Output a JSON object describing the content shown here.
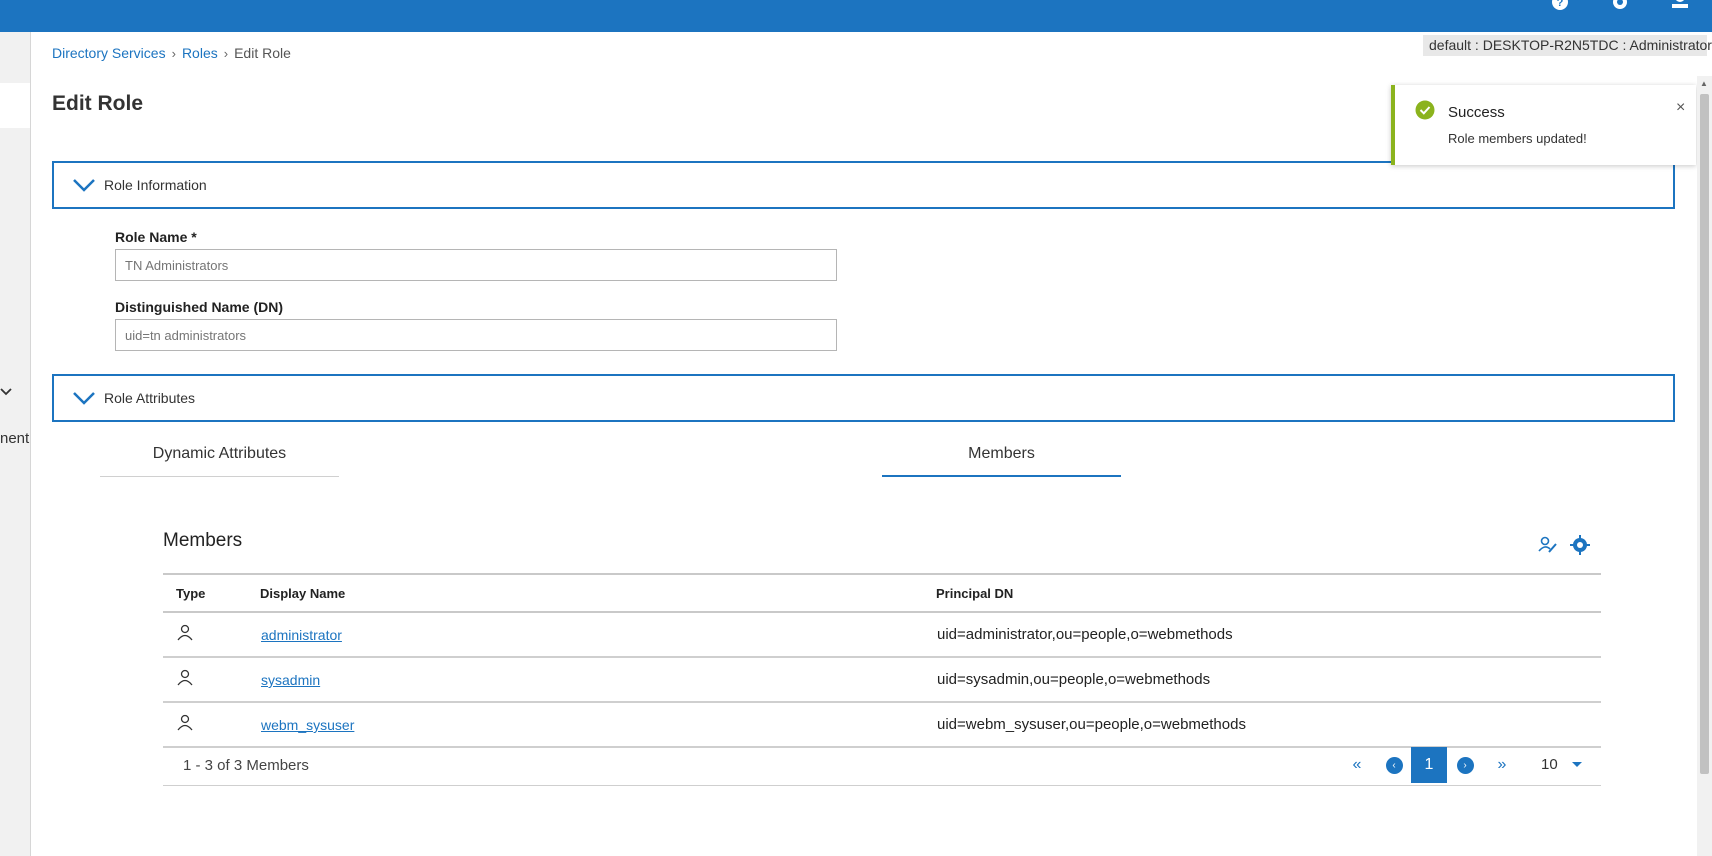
{
  "header": {
    "icons": [
      "help-icon",
      "settings-icon",
      "user-icon"
    ]
  },
  "sidebar": {
    "truncated_label": "nent"
  },
  "breadcrumb": {
    "items": [
      "Directory Services",
      "Roles",
      "Edit Role"
    ]
  },
  "context": "default : DESKTOP-R2N5TDC : Administrator",
  "page_title": "Edit Role",
  "sections": {
    "role_information": "Role Information",
    "role_attributes": "Role Attributes"
  },
  "form": {
    "role_name_label": "Role Name *",
    "role_name_value": "TN Administrators",
    "dn_label": "Distinguished Name (DN)",
    "dn_value": "uid=tn administrators"
  },
  "tabs": [
    {
      "label": "Dynamic Attributes",
      "active": false
    },
    {
      "label": "Members",
      "active": true
    }
  ],
  "members": {
    "title": "Members",
    "columns": [
      "Type",
      "Display Name",
      "Principal DN"
    ],
    "rows": [
      {
        "type": "user-icon",
        "display_name": "administrator",
        "principal_dn": "uid=administrator,ou=people,o=webmethods"
      },
      {
        "type": "user-icon",
        "display_name": "sysadmin",
        "principal_dn": "uid=sysadmin,ou=people,o=webmethods"
      },
      {
        "type": "user-icon",
        "display_name": "webm_sysuser",
        "principal_dn": "uid=webm_sysuser,ou=people,o=webmethods"
      }
    ],
    "count_text": "1 - 3 of 3 Members",
    "pagination": {
      "current_page": "1",
      "page_size": "10"
    }
  },
  "toast": {
    "title": "Success",
    "message": "Role members updated!",
    "close": "×"
  },
  "colors": {
    "primary": "#1c74c0",
    "success": "#8bb31d"
  }
}
